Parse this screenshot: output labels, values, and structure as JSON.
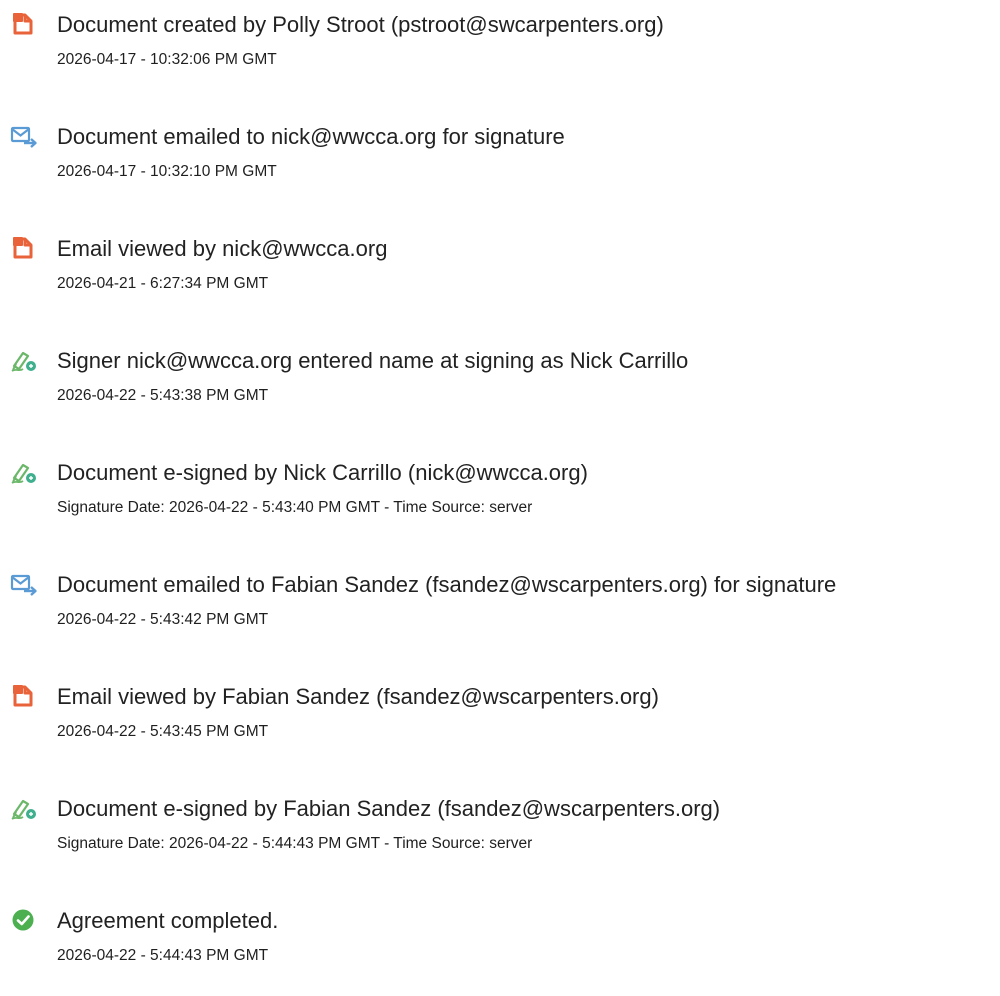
{
  "events": [
    {
      "icon": "document-icon",
      "title": "Document created by Polly Stroot (pstroot@swcarpenters.org)",
      "meta": "2026-04-17 - 10:32:06 PM GMT"
    },
    {
      "icon": "email-send-icon",
      "title": "Document emailed to nick@wwcca.org for signature",
      "meta": "2026-04-17 - 10:32:10 PM GMT"
    },
    {
      "icon": "document-icon",
      "title": "Email viewed by nick@wwcca.org",
      "meta": "2026-04-21 - 6:27:34 PM GMT"
    },
    {
      "icon": "pen-signature-icon",
      "title": "Signer nick@wwcca.org entered name at signing as Nick Carrillo",
      "meta": "2026-04-22 - 5:43:38 PM GMT"
    },
    {
      "icon": "pen-signature-icon",
      "title": "Document e-signed by Nick Carrillo (nick@wwcca.org)",
      "meta": "Signature Date: 2026-04-22 - 5:43:40 PM GMT - Time Source: server"
    },
    {
      "icon": "email-send-icon",
      "title": "Document emailed to Fabian Sandez (fsandez@wscarpenters.org) for signature",
      "meta": "2026-04-22 - 5:43:42 PM GMT"
    },
    {
      "icon": "document-icon",
      "title": "Email viewed by Fabian Sandez (fsandez@wscarpenters.org)",
      "meta": "2026-04-22 - 5:43:45 PM GMT"
    },
    {
      "icon": "pen-signature-icon",
      "title": "Document e-signed by Fabian Sandez (fsandez@wscarpenters.org)",
      "meta": "Signature Date: 2026-04-22 - 5:44:43 PM GMT - Time Source: server"
    },
    {
      "icon": "checkmark-circle-icon",
      "title": "Agreement completed.",
      "meta": "2026-04-22 - 5:44:43 PM GMT"
    }
  ],
  "colors": {
    "document_icon": "#E8623A",
    "email_icon": "#5B9BD5",
    "pen_icon": "#6BB86A",
    "check_icon": "#4CAF50",
    "text": "#222222"
  }
}
